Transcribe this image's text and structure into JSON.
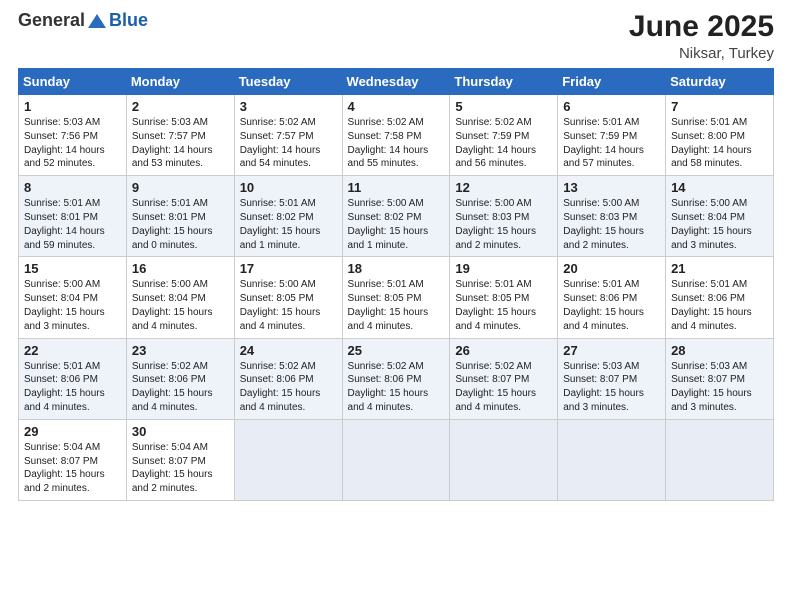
{
  "header": {
    "logo_general": "General",
    "logo_blue": "Blue",
    "month_year": "June 2025",
    "location": "Niksar, Turkey"
  },
  "weekdays": [
    "Sunday",
    "Monday",
    "Tuesday",
    "Wednesday",
    "Thursday",
    "Friday",
    "Saturday"
  ],
  "weeks": [
    [
      {
        "day": "1",
        "info": "Sunrise: 5:03 AM\nSunset: 7:56 PM\nDaylight: 14 hours\nand 52 minutes."
      },
      {
        "day": "2",
        "info": "Sunrise: 5:03 AM\nSunset: 7:57 PM\nDaylight: 14 hours\nand 53 minutes."
      },
      {
        "day": "3",
        "info": "Sunrise: 5:02 AM\nSunset: 7:57 PM\nDaylight: 14 hours\nand 54 minutes."
      },
      {
        "day": "4",
        "info": "Sunrise: 5:02 AM\nSunset: 7:58 PM\nDaylight: 14 hours\nand 55 minutes."
      },
      {
        "day": "5",
        "info": "Sunrise: 5:02 AM\nSunset: 7:59 PM\nDaylight: 14 hours\nand 56 minutes."
      },
      {
        "day": "6",
        "info": "Sunrise: 5:01 AM\nSunset: 7:59 PM\nDaylight: 14 hours\nand 57 minutes."
      },
      {
        "day": "7",
        "info": "Sunrise: 5:01 AM\nSunset: 8:00 PM\nDaylight: 14 hours\nand 58 minutes."
      }
    ],
    [
      {
        "day": "8",
        "info": "Sunrise: 5:01 AM\nSunset: 8:01 PM\nDaylight: 14 hours\nand 59 minutes."
      },
      {
        "day": "9",
        "info": "Sunrise: 5:01 AM\nSunset: 8:01 PM\nDaylight: 15 hours\nand 0 minutes."
      },
      {
        "day": "10",
        "info": "Sunrise: 5:01 AM\nSunset: 8:02 PM\nDaylight: 15 hours\nand 1 minute."
      },
      {
        "day": "11",
        "info": "Sunrise: 5:00 AM\nSunset: 8:02 PM\nDaylight: 15 hours\nand 1 minute."
      },
      {
        "day": "12",
        "info": "Sunrise: 5:00 AM\nSunset: 8:03 PM\nDaylight: 15 hours\nand 2 minutes."
      },
      {
        "day": "13",
        "info": "Sunrise: 5:00 AM\nSunset: 8:03 PM\nDaylight: 15 hours\nand 2 minutes."
      },
      {
        "day": "14",
        "info": "Sunrise: 5:00 AM\nSunset: 8:04 PM\nDaylight: 15 hours\nand 3 minutes."
      }
    ],
    [
      {
        "day": "15",
        "info": "Sunrise: 5:00 AM\nSunset: 8:04 PM\nDaylight: 15 hours\nand 3 minutes."
      },
      {
        "day": "16",
        "info": "Sunrise: 5:00 AM\nSunset: 8:04 PM\nDaylight: 15 hours\nand 4 minutes."
      },
      {
        "day": "17",
        "info": "Sunrise: 5:00 AM\nSunset: 8:05 PM\nDaylight: 15 hours\nand 4 minutes."
      },
      {
        "day": "18",
        "info": "Sunrise: 5:01 AM\nSunset: 8:05 PM\nDaylight: 15 hours\nand 4 minutes."
      },
      {
        "day": "19",
        "info": "Sunrise: 5:01 AM\nSunset: 8:05 PM\nDaylight: 15 hours\nand 4 minutes."
      },
      {
        "day": "20",
        "info": "Sunrise: 5:01 AM\nSunset: 8:06 PM\nDaylight: 15 hours\nand 4 minutes."
      },
      {
        "day": "21",
        "info": "Sunrise: 5:01 AM\nSunset: 8:06 PM\nDaylight: 15 hours\nand 4 minutes."
      }
    ],
    [
      {
        "day": "22",
        "info": "Sunrise: 5:01 AM\nSunset: 8:06 PM\nDaylight: 15 hours\nand 4 minutes."
      },
      {
        "day": "23",
        "info": "Sunrise: 5:02 AM\nSunset: 8:06 PM\nDaylight: 15 hours\nand 4 minutes."
      },
      {
        "day": "24",
        "info": "Sunrise: 5:02 AM\nSunset: 8:06 PM\nDaylight: 15 hours\nand 4 minutes."
      },
      {
        "day": "25",
        "info": "Sunrise: 5:02 AM\nSunset: 8:06 PM\nDaylight: 15 hours\nand 4 minutes."
      },
      {
        "day": "26",
        "info": "Sunrise: 5:02 AM\nSunset: 8:07 PM\nDaylight: 15 hours\nand 4 minutes."
      },
      {
        "day": "27",
        "info": "Sunrise: 5:03 AM\nSunset: 8:07 PM\nDaylight: 15 hours\nand 3 minutes."
      },
      {
        "day": "28",
        "info": "Sunrise: 5:03 AM\nSunset: 8:07 PM\nDaylight: 15 hours\nand 3 minutes."
      }
    ],
    [
      {
        "day": "29",
        "info": "Sunrise: 5:04 AM\nSunset: 8:07 PM\nDaylight: 15 hours\nand 2 minutes."
      },
      {
        "day": "30",
        "info": "Sunrise: 5:04 AM\nSunset: 8:07 PM\nDaylight: 15 hours\nand 2 minutes."
      },
      {
        "day": "",
        "info": ""
      },
      {
        "day": "",
        "info": ""
      },
      {
        "day": "",
        "info": ""
      },
      {
        "day": "",
        "info": ""
      },
      {
        "day": "",
        "info": ""
      }
    ]
  ]
}
